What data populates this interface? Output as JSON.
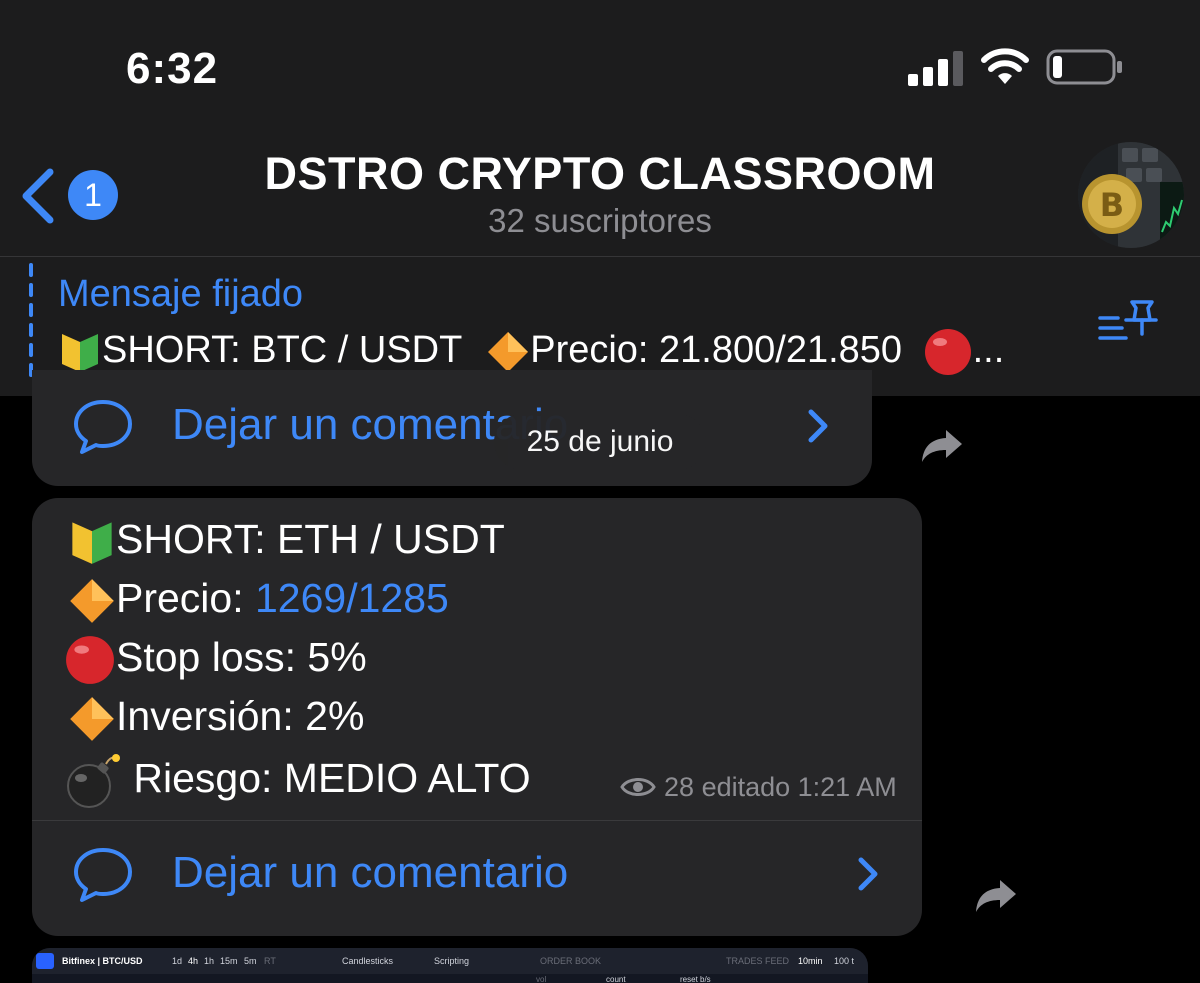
{
  "status_bar": {
    "time": "6:32"
  },
  "header": {
    "back_badge": "1",
    "title": "DSTRO CRYPTO CLASSROOM",
    "subtitle": "32 suscriptores"
  },
  "pinned": {
    "label": "Mensaje fijado",
    "preview_text_1": "SHORT: BTC / USDT",
    "preview_text_2": "Precio: 21.800/21.850",
    "ellipsis": "..."
  },
  "date_pill": "25 de junio",
  "previous_message": {
    "comment_label": "Dejar un comentario"
  },
  "message": {
    "line1_text": "SHORT: ETH / USDT",
    "line2_label": "Precio: ",
    "line2_value": "1269/1285",
    "line3_text": "Stop loss: 5%",
    "line4_text": "Inversión: 2%",
    "line5_text": " Riesgo:  MEDIO ALTO",
    "views": "28",
    "edited_time": "editado 1:21 AM",
    "comment_label": "Dejar un comentario"
  },
  "next_message_preview": {
    "exchange": "Bitfinex | BTC/USD",
    "timeframes": [
      "1d",
      "4h",
      "1h",
      "15m",
      "5m",
      "RT"
    ],
    "candlesticks": "Candlesticks",
    "scripting": "Scripting",
    "order_book": "ORDER BOOK",
    "trades_feed": "TRADES FEED",
    "trades_interval": "10min",
    "trades_count": "100 t",
    "count_label": "count",
    "reset_label": "reset b/s",
    "vol_label": "vol"
  },
  "colors": {
    "accent": "#3e88f7",
    "bubble": "#262628",
    "header_bg": "#1c1c1d",
    "secondary_text": "#8e8e93"
  },
  "icons": {
    "jp_beginner": "japanese-beginner-symbol-icon",
    "orange_diamond": "orange-diamond-icon",
    "red_circle": "red-circle-icon",
    "bomb": "bomb-icon"
  }
}
